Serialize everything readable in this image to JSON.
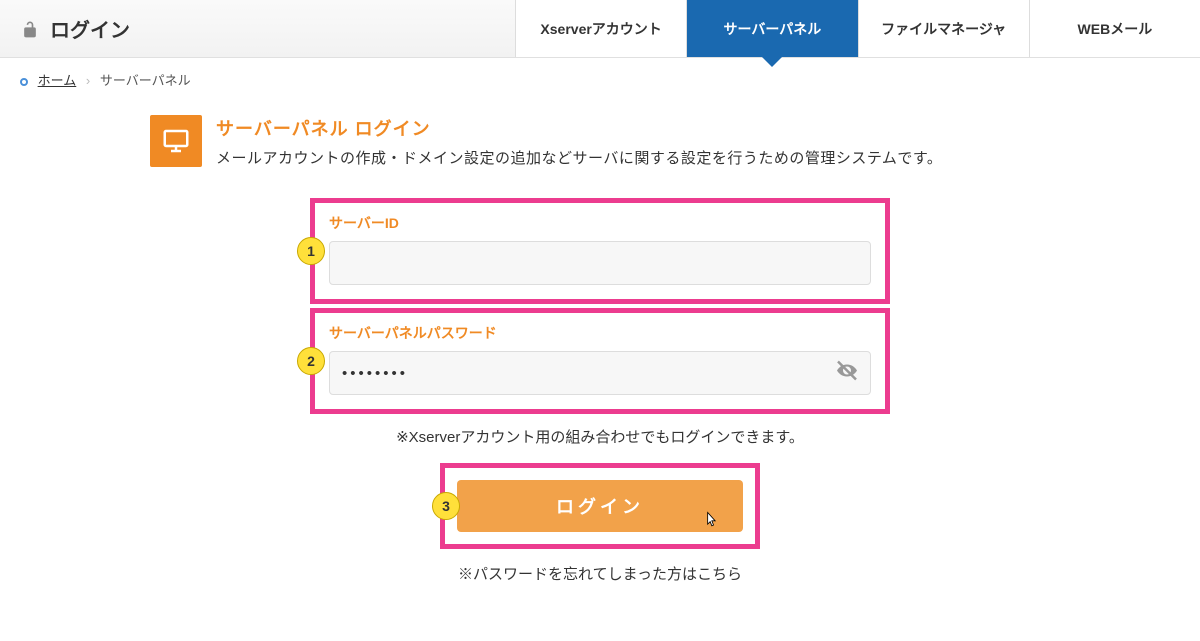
{
  "header": {
    "title": "ログイン",
    "tabs": [
      {
        "label": "Xserverアカウント",
        "active": false
      },
      {
        "label": "サーバーパネル",
        "active": true
      },
      {
        "label": "ファイルマネージャ",
        "active": false
      },
      {
        "label": "WEBメール",
        "active": false
      }
    ]
  },
  "breadcrumb": {
    "home": "ホーム",
    "current": "サーバーパネル"
  },
  "intro": {
    "title": "サーバーパネル ログイン",
    "desc": "メールアカウントの作成・ドメイン設定の追加などサーバに関する設定を行うための管理システムです。"
  },
  "form": {
    "server_id_label": "サーバーID",
    "server_id_value": "",
    "password_label": "サーバーパネルパスワード",
    "password_value": "••••••••",
    "hint": "※Xserverアカウント用の組み合わせでもログインできます。",
    "submit_label": "ログイン",
    "forgot": "※パスワードを忘れてしまった方はこちら"
  },
  "annotations": {
    "a1": "1",
    "a2": "2",
    "a3": "3"
  }
}
